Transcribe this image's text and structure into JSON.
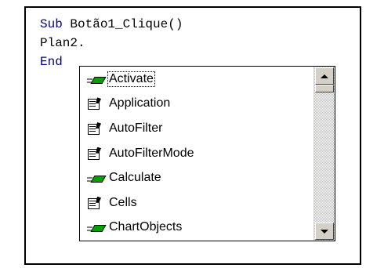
{
  "code": {
    "line1": {
      "keyword": "Sub",
      "rest": " Botão1_Clique()"
    },
    "line2": "Plan2.",
    "line3": {
      "keyword": "End"
    }
  },
  "completion": {
    "selected_index": 0,
    "items": [
      {
        "label": "Activate",
        "icon": "method-icon"
      },
      {
        "label": "Application",
        "icon": "property-icon"
      },
      {
        "label": "AutoFilter",
        "icon": "property-icon"
      },
      {
        "label": "AutoFilterMode",
        "icon": "property-icon"
      },
      {
        "label": "Calculate",
        "icon": "method-icon"
      },
      {
        "label": "Cells",
        "icon": "property-icon"
      },
      {
        "label": "ChartObjects",
        "icon": "method-icon"
      }
    ]
  },
  "colors": {
    "keyword": "#00007f",
    "method_icon": "#00a000",
    "scrollbar_face": "#d4d0c8"
  }
}
